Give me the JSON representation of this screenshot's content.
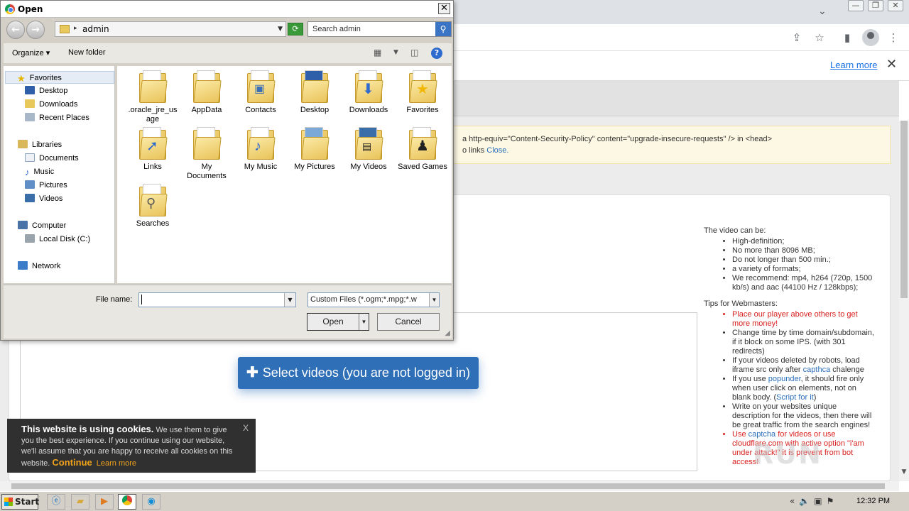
{
  "browser": {
    "learn_more": "Learn more",
    "close_glyph": "✕"
  },
  "page": {
    "warning_line1": "a http-equiv=\"Content-Security-Policy\" content=\"upgrade-insecure-requests\" /> in <head>",
    "warning_line2_prefix": "o links",
    "warning_close": "Close.",
    "select_button": "Select videos (you are not logged in)",
    "info_heading_video": "The video can be:",
    "video_points": [
      "High-definition;",
      "No more than 8096 MB;",
      "Do not longer than 500 min.;",
      "a variety of formats;",
      "We recommend: mp4, h264 (720p, 1500 kb/s) and aac (44100 Hz / 128kbps);"
    ],
    "info_heading_tips": "Tips for Webmasters:",
    "tips": {
      "t1": "Place our player above others to get more money!",
      "t2": "Change time by time domain/subdomain, if it block on some IPS. (with 301 redirects)",
      "t3_pre": "If your videos deleted by robots, load iframe src only after",
      "t3_link": "capthca",
      "t3_post": "chalenge",
      "t4_pre": "If you use",
      "t4_link": "popunder",
      "t4_mid": ", it should fire only when user click on elements, not on blank body. (",
      "t4_link2": "Script for it",
      "t4_post": ")",
      "t5": "Write on your websites unique description for the videos, then there will be great traffic from the search engines!",
      "t6_pre": "Use",
      "t6_link": "captcha",
      "t6_post": "for videos or use cloudflare.com with active option \"i'am under attack!\" it is prevent from bot access!"
    },
    "cookie_title": "This website is using cookies.",
    "cookie_text": "We use them to give you the best experience. If you continue using our website, we'll assume that you are happy to receive all cookies on this website.",
    "cookie_continue": "Continue",
    "cookie_learn": "Learn more",
    "cookie_close": "X"
  },
  "dialog": {
    "title": "Open",
    "path": "admin",
    "search_placeholder": "Search admin",
    "organize": "Organize",
    "new_folder": "New folder",
    "nav": {
      "favorites": "Favorites",
      "desktop": "Desktop",
      "downloads": "Downloads",
      "recent": "Recent Places",
      "libraries": "Libraries",
      "documents": "Documents",
      "music": "Music",
      "pictures": "Pictures",
      "videos": "Videos",
      "computer": "Computer",
      "local_disk": "Local Disk (C:)",
      "network": "Network"
    },
    "files": [
      ".oracle_jre_usage",
      "AppData",
      "Contacts",
      "Desktop",
      "Downloads",
      "Favorites",
      "Links",
      "My Documents",
      "My Music",
      "My Pictures",
      "My Videos",
      "Saved Games",
      "Searches"
    ],
    "file_name_label": "File name:",
    "file_name_value": "",
    "filter": "Custom Files (*.ogm;*.mpg;*.w",
    "open": "Open",
    "cancel": "Cancel"
  },
  "taskbar": {
    "start": "Start",
    "time": "12:32 PM"
  },
  "watermark": "RUN"
}
